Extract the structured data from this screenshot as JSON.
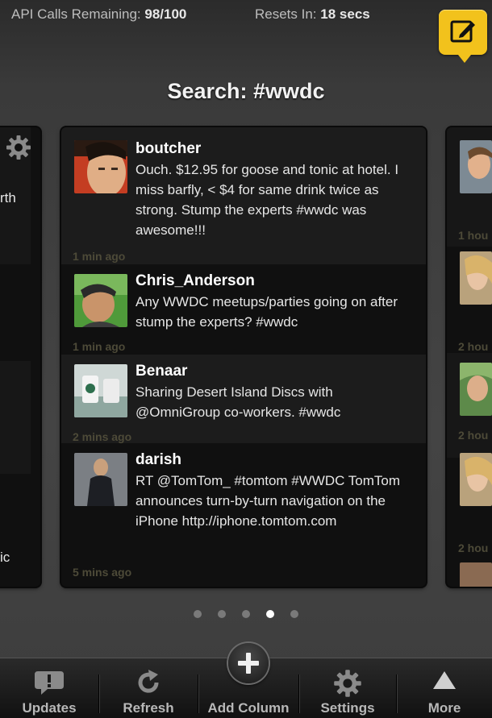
{
  "status": {
    "api_label": "API Calls Remaining:",
    "api_value": "98/100",
    "reset_label": "Resets In:",
    "reset_value": "18 secs"
  },
  "column": {
    "title": "Search: #wwdc"
  },
  "tweets": [
    {
      "user": "boutcher",
      "text": "Ouch. $12.95 for goose and tonic at hotel. I miss barfly, < $4 for same drink twice as strong.  Stump the experts #wwdc was awesome!!!",
      "ago": "1 min ago"
    },
    {
      "user": "Chris_Anderson",
      "text": "Any WWDC meetups/parties going on after stump the experts? #wwdc",
      "ago": "1 min ago"
    },
    {
      "user": "Benaar",
      "text": "Sharing Desert Island Discs with @OmniGroup co-workers. #wwdc",
      "ago": "2 mins ago"
    },
    {
      "user": "darish",
      "text": "RT @TomTom_ #tomtom #WWDC TomTom announces turn-by-turn navigation on the iPhone http://iphone.tomtom.com",
      "ago": "5 mins ago"
    }
  ],
  "left_column": {
    "fragments": [
      "rth",
      "ic"
    ]
  },
  "right_column": {
    "times": [
      "1 hou",
      "2 hou",
      "2 hou",
      "2 hou"
    ]
  },
  "pager": {
    "count": 5,
    "active": 3
  },
  "tabs": [
    {
      "label": "Updates",
      "icon": "speech-bubble-icon"
    },
    {
      "label": "Refresh",
      "icon": "refresh-icon"
    },
    {
      "label": "Add Column",
      "icon": "plus-icon"
    },
    {
      "label": "Settings",
      "icon": "gear-icon"
    },
    {
      "label": "More",
      "icon": "triangle-up-icon"
    }
  ],
  "colors": {
    "compose": "#f2c21c",
    "timestamp": "#4d4a38"
  }
}
